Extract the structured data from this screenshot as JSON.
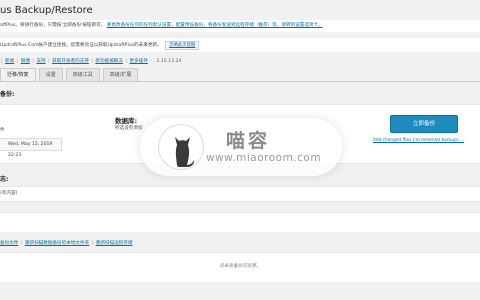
{
  "page": {
    "title": "us Backup/Restore"
  },
  "notices": {
    "line1_prefix": "aftPlus。要进行备份，只需按'立即备份'按钮即可。",
    "line1_link": "要更改备份任何的任何默认设置，配置预设备份，将备份发送到远程存储（推荐）等，请转到设置选项卡。",
    "line2_prefix": "UpdraftPlus.Com帐户建立连接。您需要验证以获取UpdraftPlus的未来更新。",
    "line2_link": "忽略此次提醒"
  },
  "top_links": {
    "items": [
      "新闻",
      "微博",
      "支持",
      "获取开发者的支持",
      "新功能被解冻",
      "更多插件"
    ],
    "version": "2.16.13.24"
  },
  "tabs": [
    "迁移/恢复",
    "设置",
    "高级工具",
    "高级/扩展"
  ],
  "backup_section": {
    "heading": "备份:",
    "files_label": "件",
    "files_status": "所选设有添加",
    "next_time": "Wed, May 15, 2019 22:23",
    "db_heading": "数据库:",
    "db_status": "所选设有添加",
    "backup_button": "立即备份",
    "add_files_link": "Add changed files (incremental backup) ..."
  },
  "log_section": {
    "heading": "志:",
    "text": "(有内容)"
  },
  "bottom_links": [
    "备份文件",
    "重新扫描数据备份的本地文件夹",
    "重新扫描远程存储"
  ],
  "existing": {
    "no_backups": "还未有备份可还原。"
  },
  "watermark": {
    "title": "喵容",
    "url": "www.miaoroom.com"
  }
}
